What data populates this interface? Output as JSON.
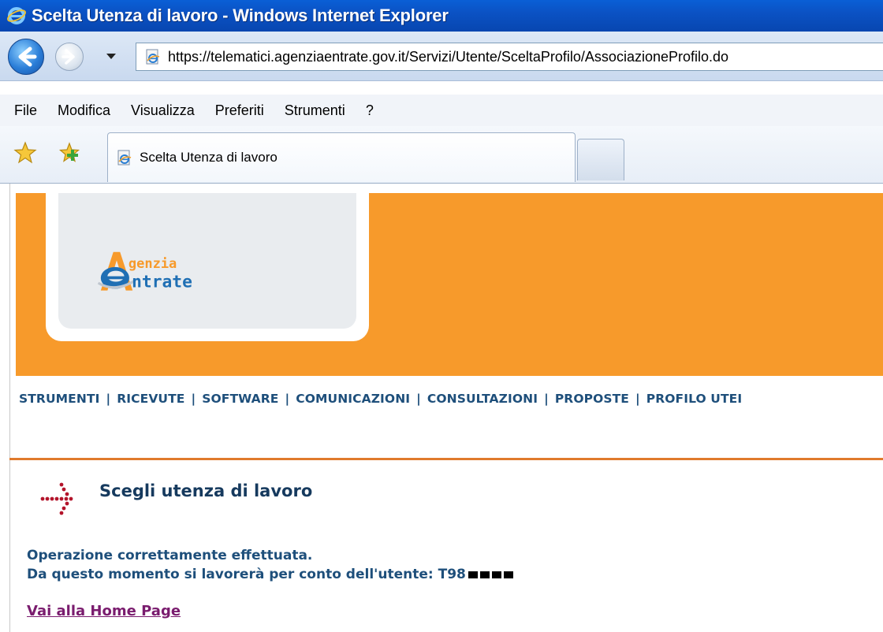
{
  "window": {
    "title": "Scelta Utenza di lavoro - Windows Internet Explorer"
  },
  "address_bar": {
    "url": "https://telematici.agenziaentrate.gov.it/Servizi/Utente/SceltaProfilo/AssociazioneProfilo.do"
  },
  "menu": {
    "items": [
      {
        "label": "File"
      },
      {
        "label": "Modifica"
      },
      {
        "label": "Visualizza"
      },
      {
        "label": "Preferiti"
      },
      {
        "label": "Strumenti"
      },
      {
        "label": "?"
      }
    ]
  },
  "tabs": [
    {
      "label": "Scelta Utenza di lavoro"
    }
  ],
  "logo": {
    "line1": "genzia",
    "line2": "ntrate",
    "colors": {
      "orange": "#f79a2b",
      "blue": "#1f6fb4"
    }
  },
  "site_nav": {
    "items": [
      {
        "label": "STRUMENTI"
      },
      {
        "label": "RICEVUTE"
      },
      {
        "label": "SOFTWARE"
      },
      {
        "label": "COMUNICAZIONI"
      },
      {
        "label": "CONSULTAZIONI"
      },
      {
        "label": "PROPOSTE"
      },
      {
        "label": "PROFILO UTEI"
      }
    ],
    "separator": "|"
  },
  "main": {
    "title": "Scegli utenza di lavoro",
    "message_line1": "Operazione correttamente effettuata.",
    "message_line2": "Da questo momento si lavorerà per conto dell'utente: T98",
    "home_link": "Vai alla Home Page"
  },
  "colors": {
    "title_bar": "#0b52c4",
    "banner_orange": "#f79a2b",
    "rule_orange": "#e07a2c",
    "text_blue": "#1e4f7b",
    "link_visited": "#7a1c6e"
  }
}
